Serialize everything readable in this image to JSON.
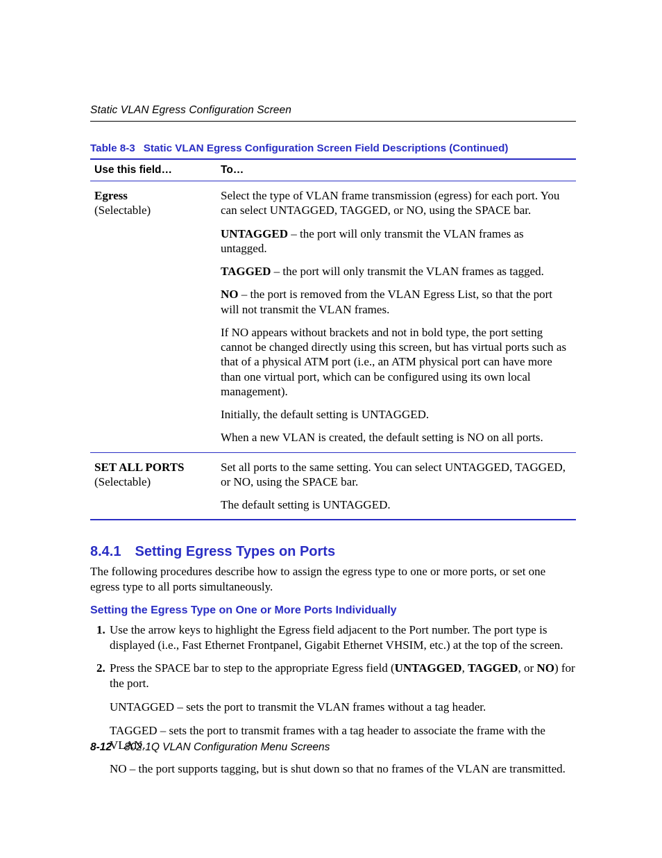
{
  "runningHead": "Static VLAN Egress Configuration Screen",
  "table": {
    "label": "Table 8-3",
    "title": "Static VLAN Egress Configuration Screen Field Descriptions (Continued)",
    "headers": {
      "c1": "Use this field…",
      "c2": "To…"
    },
    "rows": [
      {
        "field_bold": "Egress",
        "field_sub": "(Selectable)",
        "paras": [
          {
            "plain": "Select the type of VLAN frame transmission (egress) for each port. You can select UNTAGGED, TAGGED, or NO, using the SPACE bar."
          },
          {
            "lead_bold": "UNTAGGED",
            "rest": " – the port will only transmit the VLAN frames as untagged."
          },
          {
            "lead_bold": "TAGGED",
            "rest": " – the port will only transmit the VLAN frames as tagged."
          },
          {
            "lead_bold": "NO",
            "rest": " – the port is removed from the VLAN Egress List, so that the port will not transmit the VLAN frames."
          },
          {
            "plain": "If NO appears without brackets and not in bold type, the port setting cannot be changed directly using this screen, but has virtual ports such as that of a physical ATM port (i.e., an ATM physical port can have more than one virtual port, which can be configured using its own local management)."
          },
          {
            "plain": "Initially, the default setting is UNTAGGED."
          },
          {
            "plain": "When a new VLAN is created, the default setting is NO on all ports."
          }
        ]
      },
      {
        "field_bold": "SET ALL PORTS",
        "field_sub": "(Selectable)",
        "paras": [
          {
            "plain": "Set all ports to the same setting. You can select UNTAGGED, TAGGED, or NO, using the SPACE bar."
          },
          {
            "plain": "The default setting is UNTAGGED."
          }
        ]
      }
    ]
  },
  "section": {
    "number": "8.4.1",
    "title": "Setting Egress Types on Ports",
    "intro": "The following procedures describe how to assign the egress type to one or more ports, or set one egress type to all ports simultaneously.",
    "subhead": "Setting the Egress Type on One or More Ports Individually",
    "steps": [
      {
        "text": "Use the arrow keys to highlight the Egress field adjacent to the Port number. The port type is displayed (i.e., Fast Ethernet Frontpanel, Gigabit Ethernet VHSIM, etc.) at the top of the screen.",
        "subs": []
      },
      {
        "pre": "Press the SPACE bar to step to the appropriate Egress field (",
        "b1": "UNTAGGED",
        "sep1": ", ",
        "b2": "TAGGED",
        "sep2": ", or ",
        "b3": "NO",
        "post": ") for the port.",
        "subs": [
          "UNTAGGED – sets the port to transmit the VLAN frames without a tag header.",
          "TAGGED – sets the port to transmit frames with a tag header to associate the frame with the VLAN.",
          "NO – the port supports tagging, but is shut down so that no frames of the VLAN are transmitted."
        ]
      }
    ]
  },
  "footer": {
    "pageNum": "8-12",
    "chapter": "802.1Q VLAN Configuration Menu Screens"
  }
}
